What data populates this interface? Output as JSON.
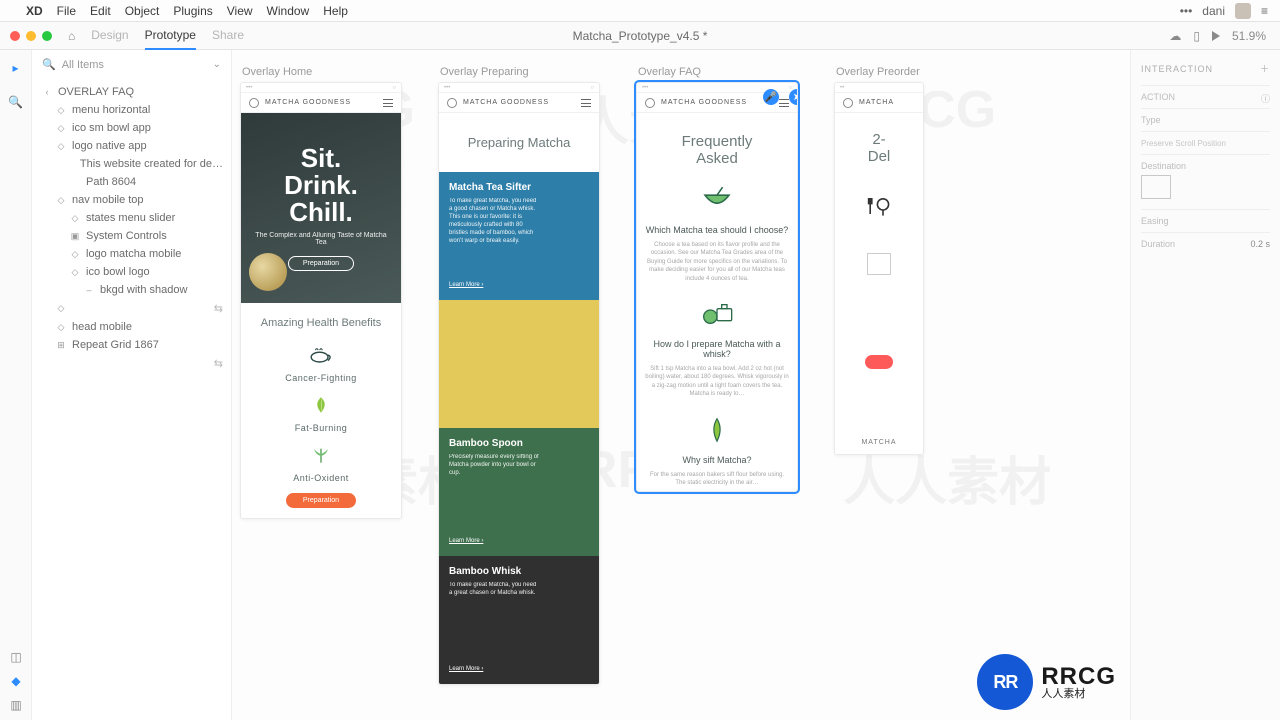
{
  "menubar": {
    "apple": "",
    "app": "XD",
    "items": [
      "File",
      "Edit",
      "Object",
      "Plugins",
      "View",
      "Window",
      "Help"
    ],
    "more": "•••",
    "user": "dani"
  },
  "toolbar": {
    "tabs": {
      "design": "Design",
      "prototype": "Prototype",
      "share": "Share"
    },
    "doc_title": "Matcha_Prototype_v4.5 *",
    "zoom": "51.9%"
  },
  "sidebar": {
    "search": "All Items",
    "tree": [
      {
        "label": "OVERLAY FAQ",
        "indent": 0,
        "ico": "‹"
      },
      {
        "label": "menu horizontal",
        "indent": 1,
        "ico": "◇"
      },
      {
        "label": "ico sm bowl app",
        "indent": 1,
        "ico": "◇"
      },
      {
        "label": "logo native app",
        "indent": 1,
        "ico": "◇"
      },
      {
        "label": "This website created for de…",
        "indent": 2,
        "ico": ""
      },
      {
        "label": "Path 8604",
        "indent": 2,
        "ico": ""
      },
      {
        "label": "nav mobile top",
        "indent": 1,
        "ico": "◇"
      },
      {
        "label": "states menu slider",
        "indent": 2,
        "ico": "◇"
      },
      {
        "label": "System Controls",
        "indent": 2,
        "ico": "▣"
      },
      {
        "label": "logo matcha mobile",
        "indent": 2,
        "ico": "◇"
      },
      {
        "label": "ico bowl logo",
        "indent": 2,
        "ico": "◇"
      },
      {
        "label": "bkgd with shadow",
        "indent": 3,
        "ico": "–"
      },
      {
        "label": "",
        "indent": 1,
        "ico": "◇",
        "trail": "⇆"
      },
      {
        "label": "head mobile",
        "indent": 1,
        "ico": "◇"
      },
      {
        "label": "Repeat Grid 1867",
        "indent": 1,
        "ico": "⊞"
      },
      {
        "label": "",
        "indent": 1,
        "ico": "",
        "trail": "⇆"
      }
    ]
  },
  "artboards": {
    "a1": {
      "label": "Overlay Home",
      "brand": "MATCHA GOODNESS",
      "hero": {
        "line1": "Sit.",
        "line2": "Drink.",
        "line3": "Chill.",
        "sub": "The Complex and Alluring Taste of Matcha Tea",
        "cta": "Preparation"
      },
      "benefits_title": "Amazing Health Benefits",
      "benefits": [
        {
          "name": "Cancer-Fighting"
        },
        {
          "name": "Fat-Burning"
        },
        {
          "name": "Anti-Oxident"
        }
      ],
      "bottom_cta": "Preparation"
    },
    "a2": {
      "label": "Overlay Preparing",
      "brand": "MATCHA GOODNESS",
      "title": "Preparing Matcha",
      "cards": [
        {
          "title": "Matcha Tea Sifter",
          "body": "To make great Matcha, you need a good chasen or Matcha whisk. This one is our favorite: it is meticulously crafted with 80 bristles made of bamboo, which won’t warp or break easily.",
          "learn": "Learn More ›"
        },
        {
          "title": "Bamboo Spoon",
          "body": "Precisely measure every sifting of Matcha powder into your bowl or cup.",
          "learn": "Learn More ›"
        },
        {
          "title": "Bamboo Whisk",
          "body": "To make great Matcha, you need a great chasen or Matcha whisk.",
          "learn": "Learn More ›"
        }
      ]
    },
    "a3": {
      "label": "Overlay FAQ",
      "brand": "MATCHA GOODNESS",
      "title1": "Frequently",
      "title2": "Asked",
      "faqs": [
        {
          "q": "Which Matcha tea should I choose?",
          "body": "Choose a tea based on its flavor profile and the occasion. See our Matcha Tea Grades area of the Buying Guide for more specifics on the variations. To make deciding easier for you all of our Matcha teas include 4 ounces of tea."
        },
        {
          "q": "How do I prepare Matcha with a whisk?",
          "body": "Sift 1 tsp Matcha into a tea bowl. Add 2 oz hot (not boiling) water, about 180 degrees. Whisk vigorously in a zig-zag motion until a light foam covers the tea. Matcha is ready to…"
        },
        {
          "q": "Why sift Matcha?",
          "body": "For the same reason bakers sift flour before using. The static electricity in the air…"
        }
      ]
    },
    "a4": {
      "label": "Overlay Preorder",
      "brand": "MATCHA",
      "title1": "2-",
      "title2": "Del",
      "footer": "MATCHA"
    }
  },
  "rightpanel": {
    "header": "INTERACTION",
    "action_label": "ACTION",
    "type_label": "Type",
    "preserve": "Preserve Scroll Position",
    "destination_label": "Destination",
    "easing_label": "Easing",
    "duration_label": "Duration",
    "duration_value": "0.2 s"
  },
  "logo": {
    "badge": "RR",
    "big": "RRCG",
    "sub": "人人素材"
  }
}
